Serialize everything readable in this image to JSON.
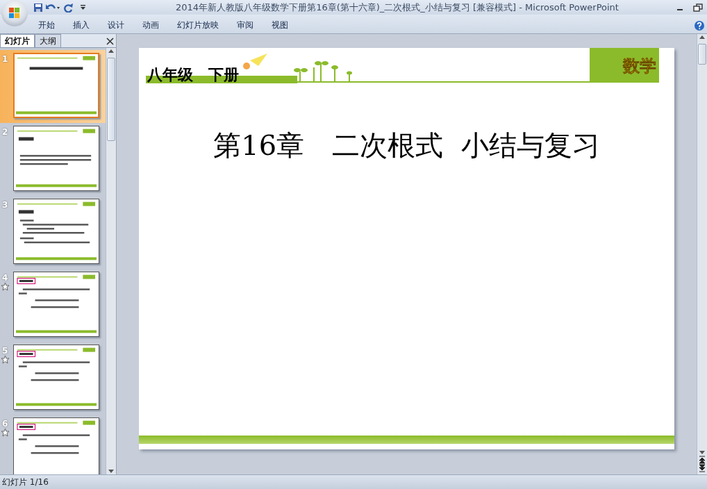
{
  "window": {
    "title": "2014年新人教版八年级数学下册第16章(第十六章)_二次根式_小结与复习 [兼容模式] - Microsoft PowerPoint"
  },
  "ribbon_tabs": [
    {
      "label": "开始",
      "selected": false
    },
    {
      "label": "插入",
      "selected": false
    },
    {
      "label": "设计",
      "selected": false
    },
    {
      "label": "动画",
      "selected": false
    },
    {
      "label": "幻灯片放映",
      "selected": false
    },
    {
      "label": "审阅",
      "selected": false
    },
    {
      "label": "视图",
      "selected": false
    }
  ],
  "panel_tabs": [
    {
      "label": "幻灯片",
      "selected": true
    },
    {
      "label": "大纲",
      "selected": false
    }
  ],
  "slides": [
    {
      "number": "1",
      "selected": true,
      "animated": false,
      "kind": "title"
    },
    {
      "number": "2",
      "selected": false,
      "animated": false,
      "kind": "text"
    },
    {
      "number": "3",
      "selected": false,
      "animated": false,
      "kind": "list"
    },
    {
      "number": "4",
      "selected": false,
      "animated": true,
      "kind": "tagged"
    },
    {
      "number": "5",
      "selected": false,
      "animated": true,
      "kind": "tagged"
    },
    {
      "number": "6",
      "selected": false,
      "animated": true,
      "kind": "tagged"
    }
  ],
  "slide": {
    "header": "八年级　下册",
    "logo": "数学",
    "title": "第16章　二次根式  小结与复习"
  },
  "status_bar": {
    "text": "幻灯片 1/16"
  }
}
